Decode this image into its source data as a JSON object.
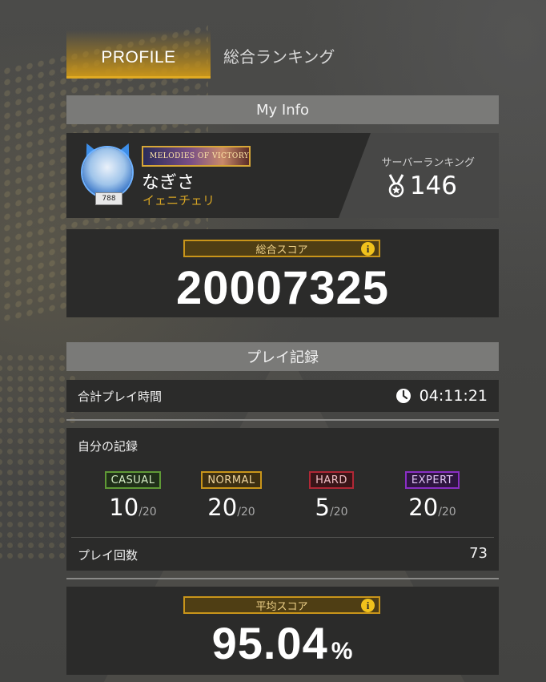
{
  "tabs": {
    "profile": "PROFILE",
    "ranking": "総合ランキング"
  },
  "my_info": {
    "header": "My Info",
    "level": "788",
    "title_plate": "MELODIES OF VICTORY",
    "username": "なぎさ",
    "team": "イェニチェリ",
    "server_ranking_label": "サーバーランキング",
    "server_rank": "146"
  },
  "total_score": {
    "label": "総合スコア",
    "value": "20007325"
  },
  "play_record": {
    "header": "プレイ記録",
    "total_time_label": "合計プレイ時間",
    "total_time": "04:11:21",
    "my_records_label": "自分の記録",
    "difficulties": [
      {
        "name": "CASUAL",
        "value": "10",
        "max": "/20"
      },
      {
        "name": "NORMAL",
        "value": "20",
        "max": "/20"
      },
      {
        "name": "HARD",
        "value": "5",
        "max": "/20"
      },
      {
        "name": "EXPERT",
        "value": "20",
        "max": "/20"
      }
    ],
    "play_count_label": "プレイ回数",
    "play_count": "73"
  },
  "average_score": {
    "label": "平均スコア",
    "value": "95.04",
    "unit": "%"
  },
  "icons": {
    "info": "info-icon",
    "clock": "clock-icon",
    "medal": "medal-icon"
  },
  "colors": {
    "accent_gold": "#c9951a",
    "casual": "#5f9a36",
    "normal": "#c9951a",
    "hard": "#b02836",
    "expert": "#8a2ec4"
  }
}
